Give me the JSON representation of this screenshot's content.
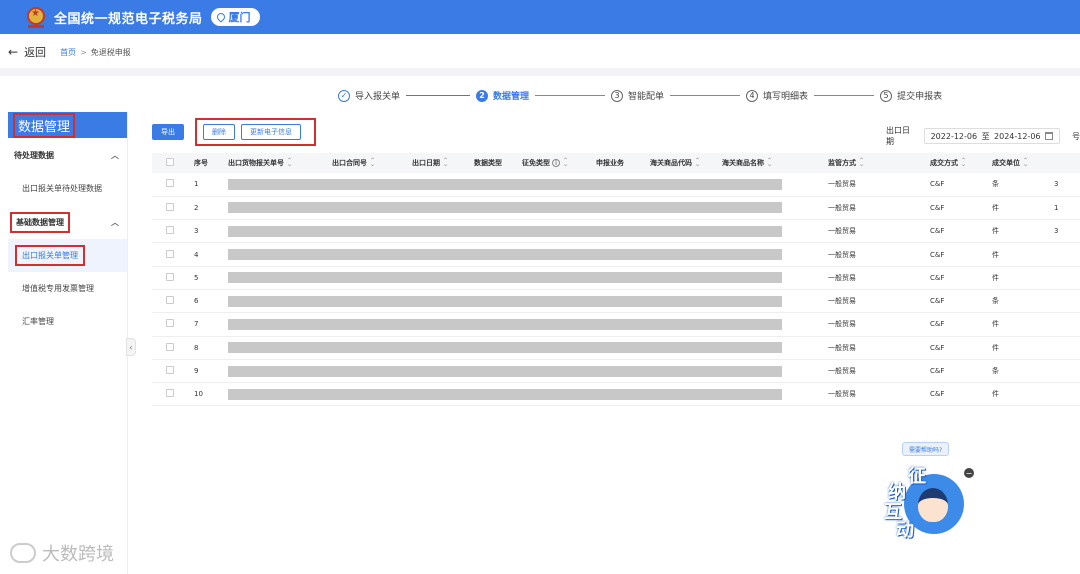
{
  "header": {
    "site_title": "全国统一规范电子税务局",
    "city": "厦门"
  },
  "nav": {
    "back_label": "返回",
    "breadcrumb_home": "首页",
    "breadcrumb_sep": ">",
    "breadcrumb_current": "免退税申报"
  },
  "steps": [
    {
      "num": "✓",
      "label": "导入报关单",
      "state": "done"
    },
    {
      "num": "2",
      "label": "数据管理",
      "state": "active"
    },
    {
      "num": "3",
      "label": "智能配单",
      "state": "todo"
    },
    {
      "num": "4",
      "label": "填写明细表",
      "state": "todo"
    },
    {
      "num": "5",
      "label": "提交申报表",
      "state": "todo"
    }
  ],
  "sidebar": {
    "title": "数据管理",
    "group1": "待处理数据",
    "group1_item1": "出口报关单待处理数据",
    "group2": "基础数据管理",
    "group2_item1": "出口报关单管理",
    "group2_item2": "增值税专用发票管理",
    "group2_item3": "汇率管理",
    "collapse": "‹"
  },
  "toolbar": {
    "export_label": "导出",
    "delete_label": "删除",
    "update_label": "更新电子信息"
  },
  "filter": {
    "date_label": "出口日期",
    "start_date": "2022-12-06",
    "date_sep": "至",
    "end_date": "2024-12-06",
    "extra_label": "号"
  },
  "table": {
    "headers": {
      "seq": "序号",
      "declaration_no": "出口货物报关单号",
      "contract_no": "出口合同号",
      "export_date": "出口日期",
      "data_type": "数据类型",
      "tax_type": "征免类型",
      "declaration_business": "申报业务",
      "hs_code": "海关商品代码",
      "hs_name": "海关商品名称",
      "supervision": "监管方式",
      "deal_method": "成交方式",
      "deal_unit": "成交单位"
    },
    "rows": [
      {
        "seq": "1",
        "supervision": "一般贸易",
        "deal_method": "C&F",
        "deal_unit": "条",
        "qty": "3"
      },
      {
        "seq": "2",
        "supervision": "一般贸易",
        "deal_method": "C&F",
        "deal_unit": "件",
        "qty": "1"
      },
      {
        "seq": "3",
        "supervision": "一般贸易",
        "deal_method": "C&F",
        "deal_unit": "件",
        "qty": "3"
      },
      {
        "seq": "4",
        "supervision": "一般贸易",
        "deal_method": "C&F",
        "deal_unit": "件",
        "qty": ""
      },
      {
        "seq": "5",
        "supervision": "一般贸易",
        "deal_method": "C&F",
        "deal_unit": "件",
        "qty": ""
      },
      {
        "seq": "6",
        "supervision": "一般贸易",
        "deal_method": "C&F",
        "deal_unit": "条",
        "qty": ""
      },
      {
        "seq": "7",
        "supervision": "一般贸易",
        "deal_method": "C&F",
        "deal_unit": "件",
        "qty": ""
      },
      {
        "seq": "8",
        "supervision": "一般贸易",
        "deal_method": "C&F",
        "deal_unit": "件",
        "qty": ""
      },
      {
        "seq": "9",
        "supervision": "一般贸易",
        "deal_method": "C&F",
        "deal_unit": "条",
        "qty": ""
      },
      {
        "seq": "10",
        "supervision": "一般贸易",
        "deal_method": "C&F",
        "deal_unit": "件",
        "qty": ""
      }
    ]
  },
  "assistant": {
    "bubble": "需要帮助吗?",
    "char1": "征",
    "char2": "纳",
    "char3": "互",
    "char4": "动",
    "close": "−"
  },
  "watermark": {
    "text": "大数跨境"
  }
}
